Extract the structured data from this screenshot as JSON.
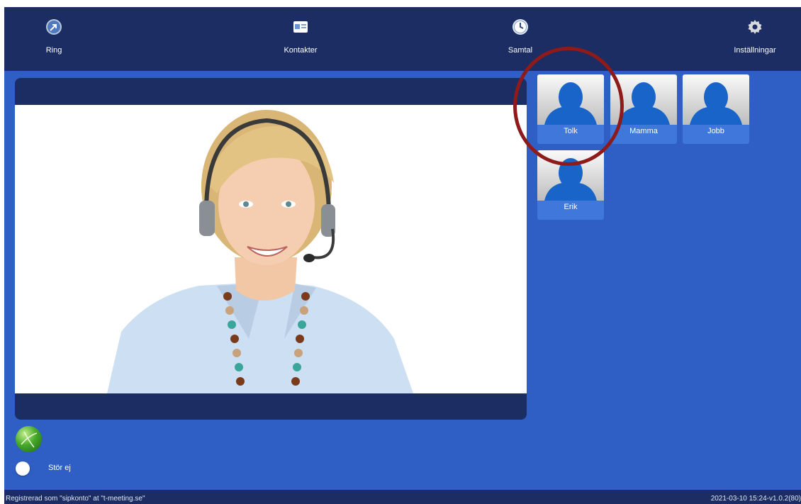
{
  "nav": {
    "items": [
      {
        "label": "Ring",
        "icon": "phone-arrow-icon"
      },
      {
        "label": "Kontakter",
        "icon": "contacts-card-icon"
      },
      {
        "label": "Samtal",
        "icon": "clock-icon"
      },
      {
        "label": "Inställningar",
        "icon": "gear-icon"
      }
    ]
  },
  "contacts": [
    {
      "name": "Tolk",
      "icon": "person-icon",
      "highlighted": true
    },
    {
      "name": "Mamma",
      "icon": "person-icon"
    },
    {
      "name": "Jobb",
      "icon": "person-icon"
    },
    {
      "name": "Erik",
      "icon": "person-icon"
    }
  ],
  "controls": {
    "globe_icon": "globe-icon",
    "dnd_label": "Stör ej",
    "dnd_enabled": false
  },
  "status": {
    "left": "Registrerad som \"sipkonto\" at \"t-meeting.se\"",
    "right": "2021-03-10 15:24-v1.0.2(80)"
  },
  "colors": {
    "background": "#2f5ec4",
    "bar": "#1b2d63",
    "contact_tile": "#3f78da",
    "highlight_ring": "#8e1a1a"
  }
}
